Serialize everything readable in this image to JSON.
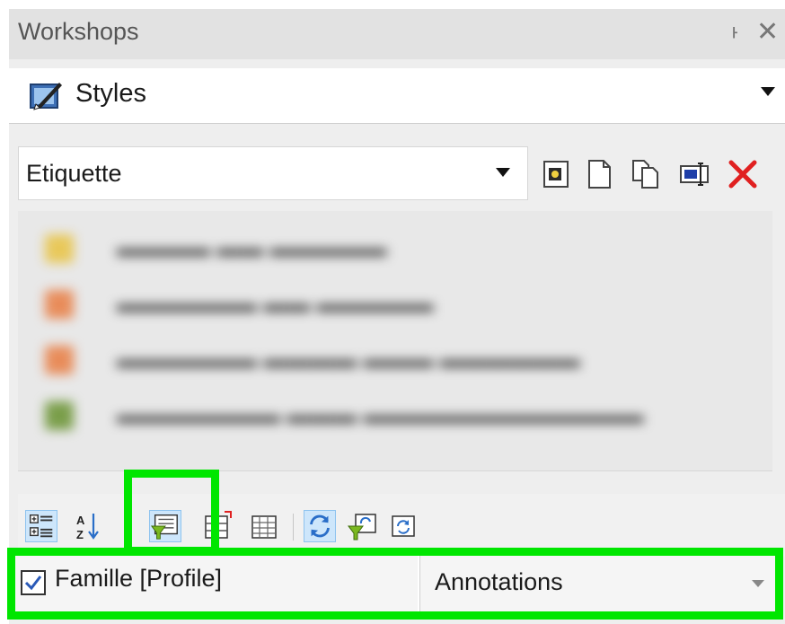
{
  "panel": {
    "title": "Workshops",
    "pin_glyph": "ᅡ",
    "close_glyph": "✕"
  },
  "workshop_selector": {
    "selected": "Styles",
    "icon": "styles-icon"
  },
  "style_selector": {
    "selected": "Etiquette"
  },
  "style_toolbar": [
    {
      "name": "apply-style-icon"
    },
    {
      "name": "new-style-icon"
    },
    {
      "name": "copy-style-icon"
    },
    {
      "name": "rename-style-icon"
    },
    {
      "name": "delete-style-icon"
    }
  ],
  "property_row": {
    "checked": true,
    "name": "Famille [Profile]",
    "value": "Annotations"
  },
  "colors": {
    "highlight": "#00e600",
    "delete_red": "#e02020"
  }
}
